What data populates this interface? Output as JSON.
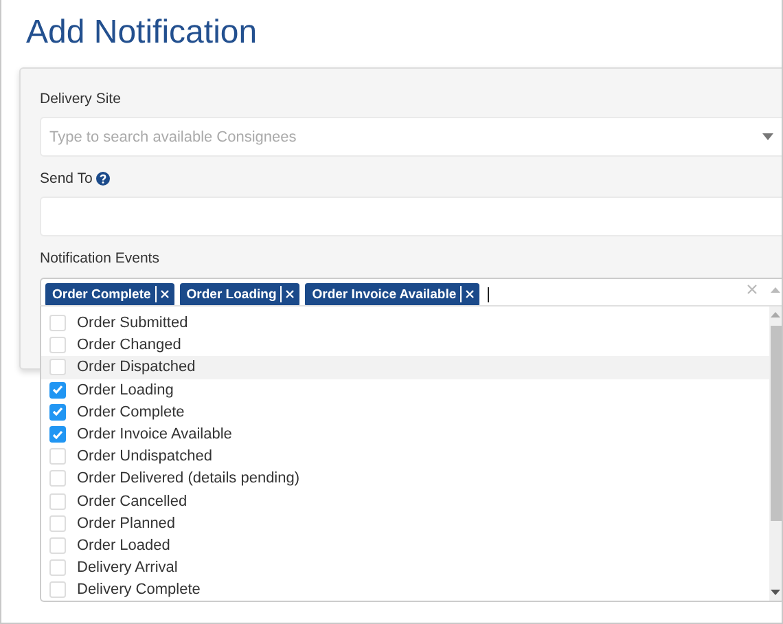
{
  "page": {
    "title": "Add Notification"
  },
  "form": {
    "delivery_site": {
      "label": "Delivery Site",
      "placeholder": "Type to search available Consignees"
    },
    "send_to": {
      "label": "Send To"
    },
    "notification_events": {
      "label": "Notification Events",
      "tags": [
        {
          "label": "Order Complete"
        },
        {
          "label": "Order Loading"
        },
        {
          "label": "Order Invoice Available"
        }
      ],
      "options": [
        {
          "label": "Order Submitted",
          "checked": false,
          "highlighted": false
        },
        {
          "label": "Order Changed",
          "checked": false,
          "highlighted": false
        },
        {
          "label": "Order Dispatched",
          "checked": false,
          "highlighted": true
        },
        {
          "label": "Order Loading",
          "checked": true,
          "highlighted": false
        },
        {
          "label": "Order Complete",
          "checked": true,
          "highlighted": false
        },
        {
          "label": "Order Invoice Available",
          "checked": true,
          "highlighted": false
        },
        {
          "label": "Order Undispatched",
          "checked": false,
          "highlighted": false
        },
        {
          "label": "Order Delivered (details pending)",
          "checked": false,
          "highlighted": false
        },
        {
          "label": "Order Cancelled",
          "checked": false,
          "highlighted": false
        },
        {
          "label": "Order Planned",
          "checked": false,
          "highlighted": false
        },
        {
          "label": "Order Loaded",
          "checked": false,
          "highlighted": false
        },
        {
          "label": "Delivery Arrival",
          "checked": false,
          "highlighted": false
        },
        {
          "label": "Delivery Complete",
          "checked": false,
          "highlighted": false
        }
      ]
    }
  }
}
